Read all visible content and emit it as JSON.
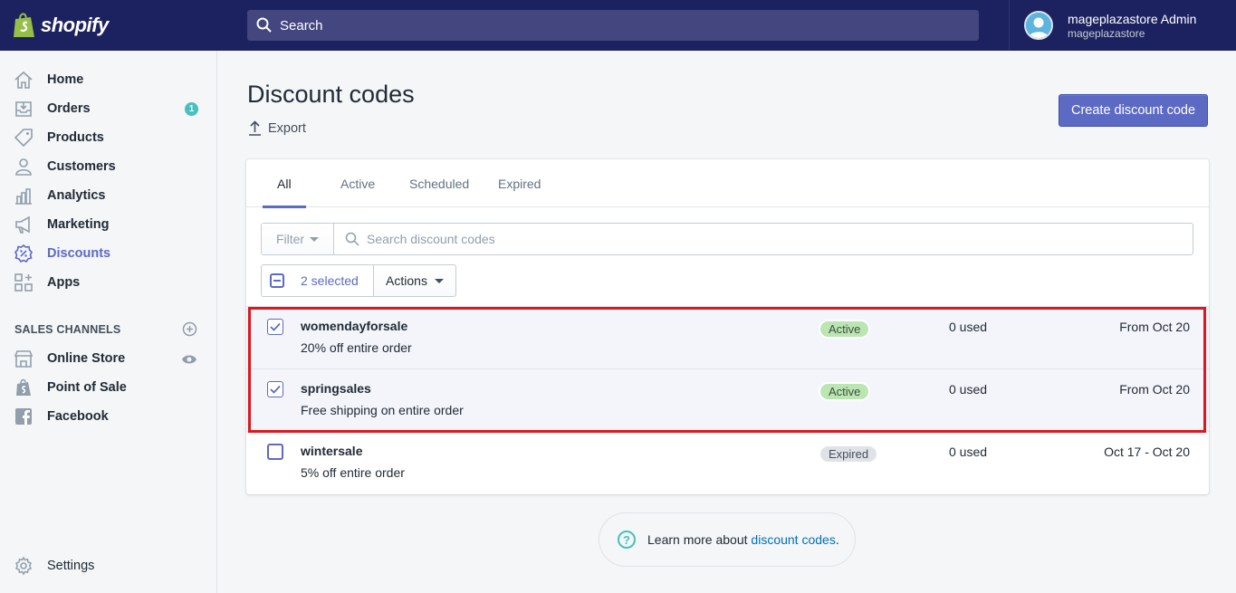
{
  "brand": {
    "name": "shopify"
  },
  "search": {
    "placeholder": "Search"
  },
  "user": {
    "name": "mageplazastore Admin",
    "store": "mageplazastore"
  },
  "sidebar": {
    "items": [
      {
        "label": "Home",
        "icon": "home-icon"
      },
      {
        "label": "Orders",
        "icon": "orders-icon",
        "badge": "1"
      },
      {
        "label": "Products",
        "icon": "tag-icon"
      },
      {
        "label": "Customers",
        "icon": "person-icon"
      },
      {
        "label": "Analytics",
        "icon": "bar-chart-icon"
      },
      {
        "label": "Marketing",
        "icon": "megaphone-icon"
      },
      {
        "label": "Discounts",
        "icon": "discount-icon",
        "active": true
      },
      {
        "label": "Apps",
        "icon": "apps-icon"
      }
    ],
    "sales_channels_heading": "SALES CHANNELS",
    "channels": [
      {
        "label": "Online Store",
        "icon": "store-icon"
      },
      {
        "label": "Point of Sale",
        "icon": "pos-bag-icon"
      },
      {
        "label": "Facebook",
        "icon": "facebook-icon"
      }
    ],
    "settings_label": "Settings"
  },
  "page": {
    "title": "Discount codes",
    "export_label": "Export",
    "create_button": "Create discount code"
  },
  "tabs": [
    "All",
    "Active",
    "Scheduled",
    "Expired"
  ],
  "filter": {
    "button": "Filter",
    "search_placeholder": "Search discount codes"
  },
  "bulk": {
    "selected_label": "2 selected",
    "actions_label": "Actions"
  },
  "discounts": [
    {
      "code": "womendayforsale",
      "description": "20% off entire order",
      "status": "Active",
      "used": "0 used",
      "dates": "From Oct 20",
      "checked": true
    },
    {
      "code": "springsales",
      "description": "Free shipping on entire order",
      "status": "Active",
      "used": "0 used",
      "dates": "From Oct 20",
      "checked": true
    },
    {
      "code": "wintersale",
      "description": "5% off entire order",
      "status": "Expired",
      "used": "0 used",
      "dates": "Oct 17 - Oct 20",
      "checked": false
    }
  ],
  "learn_more": {
    "prefix": "Learn more about ",
    "link": "discount codes",
    "suffix": "."
  },
  "colors": {
    "topbar": "#1c2260",
    "accent": "#5c6ac4",
    "active_badge": "#bbe5b3",
    "highlight_border": "#e0161e"
  }
}
